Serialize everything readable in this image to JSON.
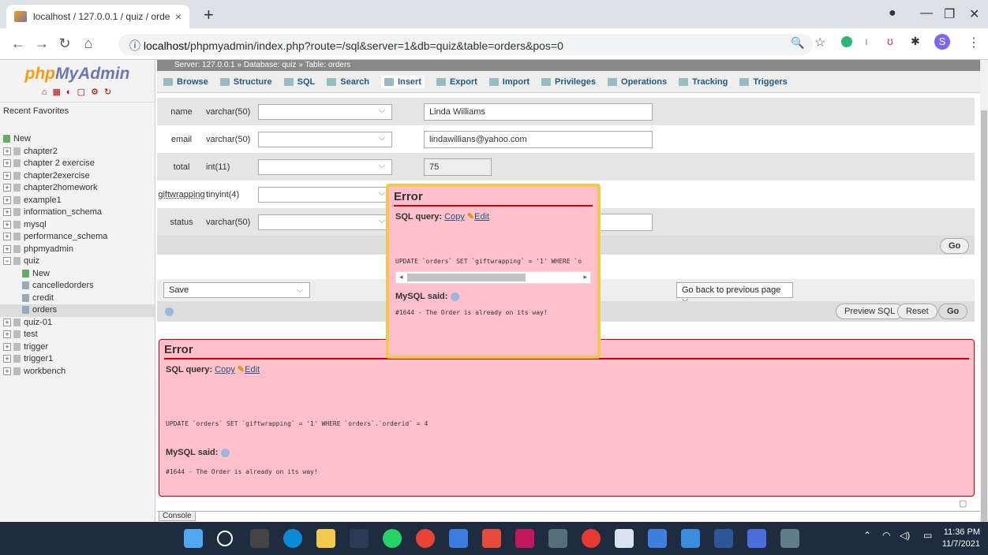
{
  "browser": {
    "tab_title": "localhost / 127.0.0.1 / quiz / orde",
    "url_host": "localhost",
    "url_path": "/phpmyadmin/index.php?route=/sql&server=1&db=quiz&table=orders&pos=0",
    "new_tab": "+",
    "tab_close": "×"
  },
  "pma": {
    "logo_php": "php",
    "logo_myadmin": "MyAdmin",
    "recent": "Recent",
    "favorites": "Favorites",
    "databases": [
      {
        "label": "New"
      },
      {
        "label": "chapter2"
      },
      {
        "label": "chapter 2 exercise"
      },
      {
        "label": "chapter2exercise"
      },
      {
        "label": "chapter2homework"
      },
      {
        "label": "example1"
      },
      {
        "label": "information_schema"
      },
      {
        "label": "mysql"
      },
      {
        "label": "performance_schema"
      },
      {
        "label": "phpmyadmin"
      },
      {
        "label": "quiz"
      },
      {
        "label": "New"
      },
      {
        "label": "cancelledorders"
      },
      {
        "label": "credit"
      },
      {
        "label": "orders"
      },
      {
        "label": "quiz-01"
      },
      {
        "label": "test"
      },
      {
        "label": "trigger"
      },
      {
        "label": "trigger1"
      },
      {
        "label": "workbench"
      }
    ],
    "breadcrumb": "Server: 127.0.0.1 » Database: quiz » Table: orders",
    "menu": [
      {
        "label": "Browse"
      },
      {
        "label": "Structure"
      },
      {
        "label": "SQL"
      },
      {
        "label": "Search"
      },
      {
        "label": "Insert"
      },
      {
        "label": "Export"
      },
      {
        "label": "Import"
      },
      {
        "label": "Privileges"
      },
      {
        "label": "Operations"
      },
      {
        "label": "Tracking"
      },
      {
        "label": "Triggers"
      }
    ],
    "fields": [
      {
        "name": "name",
        "type": "varchar(50)",
        "value": "Linda Williams"
      },
      {
        "name": "email",
        "type": "varchar(50)",
        "value": "lindawillians@yahoo.com"
      },
      {
        "name": "total",
        "type": "int(11)",
        "value": "75"
      },
      {
        "name": "giftwrapping",
        "type": "tinyint(4)",
        "value": ""
      },
      {
        "name": "status",
        "type": "varchar(50)",
        "value": ""
      }
    ],
    "go": "Go",
    "save": "Save",
    "go_back": "Go back to previous page",
    "preview_sql": "Preview SQL",
    "reset": "Reset",
    "console": "Console"
  },
  "popup_error": {
    "title": "Error",
    "sql_query_label": "SQL query:",
    "copy": "Copy",
    "edit": "Edit",
    "query": "UPDATE `orders` SET `giftwrapping` = '1' WHERE `o",
    "mysql_said": "MySQL said:",
    "message": "#1644 - The Order is already on its way!"
  },
  "main_error": {
    "title": "Error",
    "sql_query_label": "SQL query:",
    "copy": "Copy",
    "edit": "Edit",
    "query": "UPDATE `orders` SET `giftwrapping` = '1' WHERE `orders`.`orderid` = 4",
    "mysql_said": "MySQL said:",
    "message": "#1644 - The Order is already on its way!"
  },
  "taskbar": {
    "time": "11:36 PM",
    "date": "11/7/2021"
  }
}
